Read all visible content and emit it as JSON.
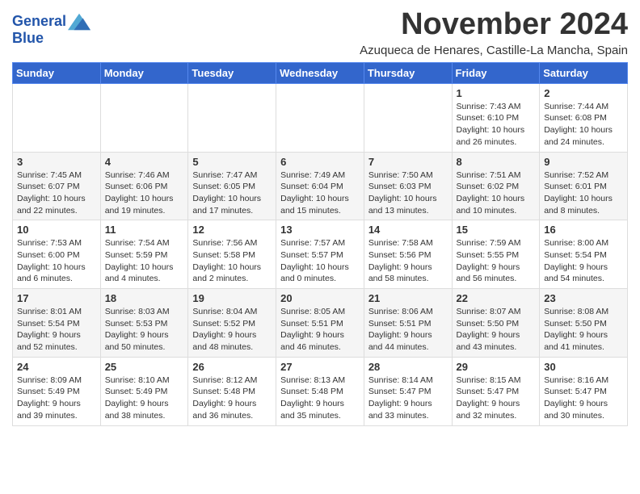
{
  "header": {
    "logo_line1": "General",
    "logo_line2": "Blue",
    "month_title": "November 2024",
    "subtitle": "Azuqueca de Henares, Castille-La Mancha, Spain"
  },
  "weekdays": [
    "Sunday",
    "Monday",
    "Tuesday",
    "Wednesday",
    "Thursday",
    "Friday",
    "Saturday"
  ],
  "weeks": [
    [
      {
        "day": "",
        "info": ""
      },
      {
        "day": "",
        "info": ""
      },
      {
        "day": "",
        "info": ""
      },
      {
        "day": "",
        "info": ""
      },
      {
        "day": "",
        "info": ""
      },
      {
        "day": "1",
        "info": "Sunrise: 7:43 AM\nSunset: 6:10 PM\nDaylight: 10 hours and 26 minutes."
      },
      {
        "day": "2",
        "info": "Sunrise: 7:44 AM\nSunset: 6:08 PM\nDaylight: 10 hours and 24 minutes."
      }
    ],
    [
      {
        "day": "3",
        "info": "Sunrise: 7:45 AM\nSunset: 6:07 PM\nDaylight: 10 hours and 22 minutes."
      },
      {
        "day": "4",
        "info": "Sunrise: 7:46 AM\nSunset: 6:06 PM\nDaylight: 10 hours and 19 minutes."
      },
      {
        "day": "5",
        "info": "Sunrise: 7:47 AM\nSunset: 6:05 PM\nDaylight: 10 hours and 17 minutes."
      },
      {
        "day": "6",
        "info": "Sunrise: 7:49 AM\nSunset: 6:04 PM\nDaylight: 10 hours and 15 minutes."
      },
      {
        "day": "7",
        "info": "Sunrise: 7:50 AM\nSunset: 6:03 PM\nDaylight: 10 hours and 13 minutes."
      },
      {
        "day": "8",
        "info": "Sunrise: 7:51 AM\nSunset: 6:02 PM\nDaylight: 10 hours and 10 minutes."
      },
      {
        "day": "9",
        "info": "Sunrise: 7:52 AM\nSunset: 6:01 PM\nDaylight: 10 hours and 8 minutes."
      }
    ],
    [
      {
        "day": "10",
        "info": "Sunrise: 7:53 AM\nSunset: 6:00 PM\nDaylight: 10 hours and 6 minutes."
      },
      {
        "day": "11",
        "info": "Sunrise: 7:54 AM\nSunset: 5:59 PM\nDaylight: 10 hours and 4 minutes."
      },
      {
        "day": "12",
        "info": "Sunrise: 7:56 AM\nSunset: 5:58 PM\nDaylight: 10 hours and 2 minutes."
      },
      {
        "day": "13",
        "info": "Sunrise: 7:57 AM\nSunset: 5:57 PM\nDaylight: 10 hours and 0 minutes."
      },
      {
        "day": "14",
        "info": "Sunrise: 7:58 AM\nSunset: 5:56 PM\nDaylight: 9 hours and 58 minutes."
      },
      {
        "day": "15",
        "info": "Sunrise: 7:59 AM\nSunset: 5:55 PM\nDaylight: 9 hours and 56 minutes."
      },
      {
        "day": "16",
        "info": "Sunrise: 8:00 AM\nSunset: 5:54 PM\nDaylight: 9 hours and 54 minutes."
      }
    ],
    [
      {
        "day": "17",
        "info": "Sunrise: 8:01 AM\nSunset: 5:54 PM\nDaylight: 9 hours and 52 minutes."
      },
      {
        "day": "18",
        "info": "Sunrise: 8:03 AM\nSunset: 5:53 PM\nDaylight: 9 hours and 50 minutes."
      },
      {
        "day": "19",
        "info": "Sunrise: 8:04 AM\nSunset: 5:52 PM\nDaylight: 9 hours and 48 minutes."
      },
      {
        "day": "20",
        "info": "Sunrise: 8:05 AM\nSunset: 5:51 PM\nDaylight: 9 hours and 46 minutes."
      },
      {
        "day": "21",
        "info": "Sunrise: 8:06 AM\nSunset: 5:51 PM\nDaylight: 9 hours and 44 minutes."
      },
      {
        "day": "22",
        "info": "Sunrise: 8:07 AM\nSunset: 5:50 PM\nDaylight: 9 hours and 43 minutes."
      },
      {
        "day": "23",
        "info": "Sunrise: 8:08 AM\nSunset: 5:50 PM\nDaylight: 9 hours and 41 minutes."
      }
    ],
    [
      {
        "day": "24",
        "info": "Sunrise: 8:09 AM\nSunset: 5:49 PM\nDaylight: 9 hours and 39 minutes."
      },
      {
        "day": "25",
        "info": "Sunrise: 8:10 AM\nSunset: 5:49 PM\nDaylight: 9 hours and 38 minutes."
      },
      {
        "day": "26",
        "info": "Sunrise: 8:12 AM\nSunset: 5:48 PM\nDaylight: 9 hours and 36 minutes."
      },
      {
        "day": "27",
        "info": "Sunrise: 8:13 AM\nSunset: 5:48 PM\nDaylight: 9 hours and 35 minutes."
      },
      {
        "day": "28",
        "info": "Sunrise: 8:14 AM\nSunset: 5:47 PM\nDaylight: 9 hours and 33 minutes."
      },
      {
        "day": "29",
        "info": "Sunrise: 8:15 AM\nSunset: 5:47 PM\nDaylight: 9 hours and 32 minutes."
      },
      {
        "day": "30",
        "info": "Sunrise: 8:16 AM\nSunset: 5:47 PM\nDaylight: 9 hours and 30 minutes."
      }
    ]
  ]
}
